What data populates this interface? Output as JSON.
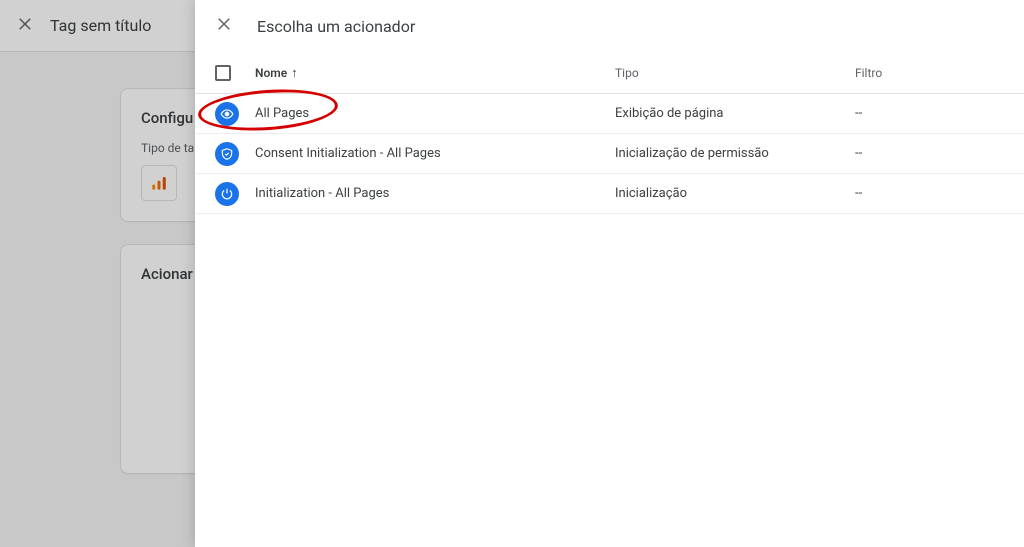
{
  "background": {
    "title": "Tag sem título",
    "config_heading": "Configu",
    "tag_type_label": "Tipo de ta",
    "trigger_heading": "Acionar"
  },
  "panel": {
    "title": "Escolha um acionador",
    "columns": {
      "name": "Nome",
      "type": "Tipo",
      "filter": "Filtro"
    },
    "rows": [
      {
        "icon": "eye",
        "name": "All Pages",
        "type": "Exibição de página",
        "filter": "--"
      },
      {
        "icon": "shield",
        "name": "Consent Initialization - All Pages",
        "type": "Inicialização de permissão",
        "filter": "--"
      },
      {
        "icon": "power",
        "name": "Initialization - All Pages",
        "type": "Inicialização",
        "filter": "--"
      }
    ]
  }
}
